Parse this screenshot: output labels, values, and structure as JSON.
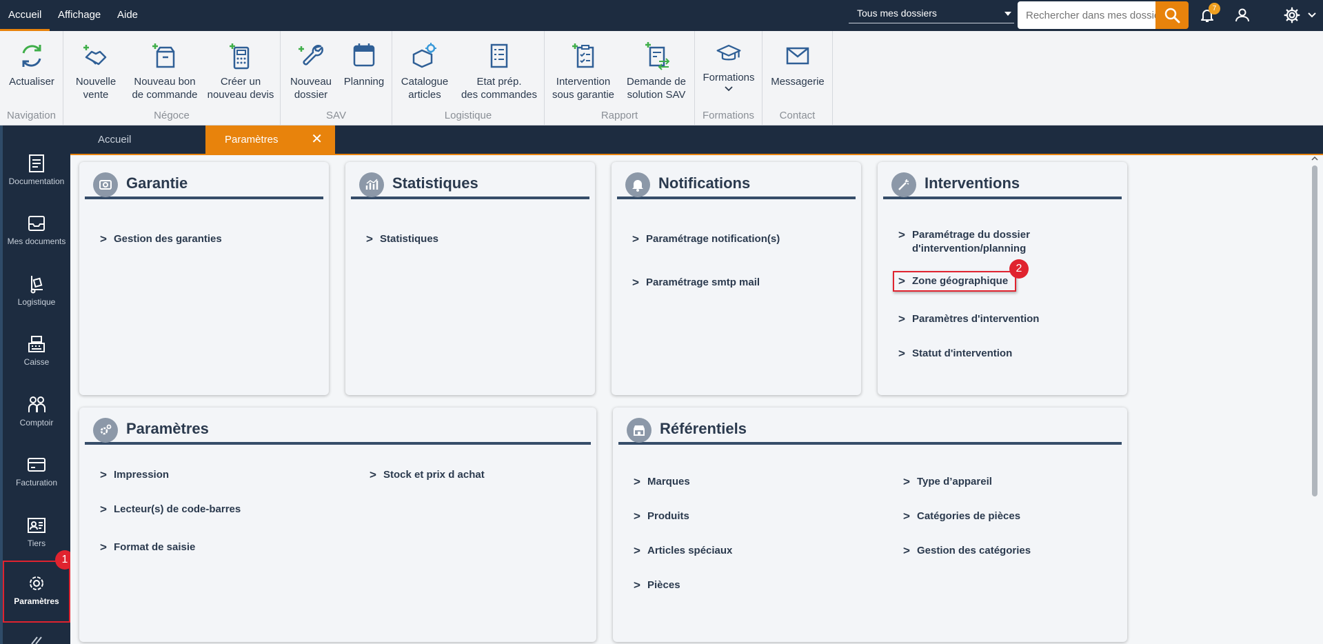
{
  "menu": {
    "items": [
      "Accueil",
      "Affichage",
      "Aide"
    ]
  },
  "topbar": {
    "dossier_select": "Tous mes dossiers",
    "search_placeholder": "Rechercher dans mes dossiers",
    "notification_count": "7"
  },
  "ribbon": {
    "groups": {
      "navigation": "Navigation",
      "negoce": "Négoce",
      "sav": "SAV",
      "logistique": "Logistique",
      "rapport": "Rapport",
      "formations": "Formations",
      "contact": "Contact"
    },
    "buttons": {
      "actualiser": "Actualiser",
      "nouvelle_vente_1": "Nouvelle",
      "nouvelle_vente_2": "vente",
      "nouveau_bon_1": "Nouveau bon",
      "nouveau_bon_2": "de commande",
      "creer_devis_1": "Créer un",
      "creer_devis_2": "nouveau devis",
      "nouveau_dossier_1": "Nouveau",
      "nouveau_dossier_2": "dossier",
      "planning": "Planning",
      "catalogue_1": "Catalogue",
      "catalogue_2": "articles",
      "etat_prep_1": "Etat prép.",
      "etat_prep_2": "des commandes",
      "intervention_1": "Intervention",
      "intervention_2": "sous garantie",
      "demande_1": "Demande de",
      "demande_2": "solution SAV",
      "formations": "Formations",
      "messagerie": "Messagerie"
    }
  },
  "sidenav": {
    "documentation": "Documentation",
    "mes_documents": "Mes documents",
    "logistique": "Logistique",
    "caisse": "Caisse",
    "comptoir": "Comptoir",
    "facturation": "Facturation",
    "tiers": "Tiers",
    "parametres": "Paramètres"
  },
  "tabs": {
    "accueil": "Accueil",
    "parametres": "Paramètres",
    "close": "✕"
  },
  "cards": {
    "garantie": {
      "title": "Garantie",
      "links": [
        "Gestion des garanties"
      ]
    },
    "statistiques": {
      "title": "Statistiques",
      "links": [
        "Statistiques"
      ]
    },
    "notifications": {
      "title": "Notifications",
      "links": [
        "Paramétrage notification(s)",
        "Paramétrage smtp mail"
      ]
    },
    "interventions": {
      "title": "Interventions",
      "link1_a": "Paramétrage du dossier",
      "link1_b": "d'intervention/planning",
      "links": [
        "Zone géographique",
        "Paramètres d'intervention",
        "Statut d'intervention"
      ]
    },
    "parametres": {
      "title": "Paramètres",
      "links": [
        "Impression",
        "Lecteur(s) de code-barres",
        "Format de saisie",
        "Stock et prix d achat"
      ]
    },
    "referentiels": {
      "title": "Référentiels",
      "links": [
        "Marques",
        "Produits",
        "Articles spéciaux",
        "Pièces",
        "Type d’appareil",
        "Catégories de pièces",
        "Gestion des catégories"
      ]
    }
  },
  "steps": {
    "one": "1",
    "two": "2"
  },
  "colors": {
    "accent": "#e8830c",
    "dark": "#1d2c40",
    "highlight": "#e0232f"
  }
}
